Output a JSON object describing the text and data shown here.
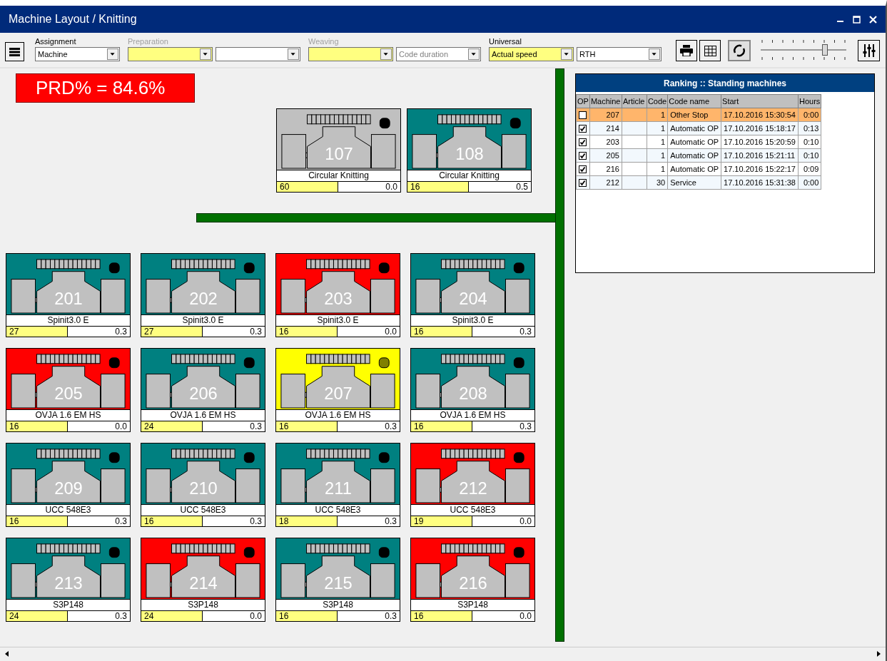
{
  "window": {
    "title": "Machine Layout / Knitting"
  },
  "toolbar": {
    "groups": [
      {
        "label": "Assignment",
        "disabled": false,
        "fields": [
          {
            "value": "Machine",
            "highlighted": false
          }
        ]
      },
      {
        "label": "Preparation",
        "disabled": true,
        "fields": [
          {
            "highlighted": true
          },
          {
            "highlighted": false
          }
        ]
      },
      {
        "label": "Weaving",
        "disabled": true,
        "fields": [
          {
            "highlighted": true
          },
          {
            "placeholder": "Code duration",
            "highlighted": false
          }
        ]
      },
      {
        "label": "Universal",
        "disabled": false,
        "fields": [
          {
            "value": "Actual speed",
            "highlighted": true
          },
          {
            "value": "RTH",
            "highlighted": false
          }
        ]
      }
    ],
    "refresh_pressed": true,
    "zoom": {
      "level": 0.75
    }
  },
  "prd": {
    "text": "PRD% = 84.6%"
  },
  "top_machines": [
    {
      "number": "107",
      "model": "Circular Knitting",
      "count": "60",
      "value": "0.0",
      "color": "#c0c0c0",
      "lamp": {
        "color": "#000000"
      }
    },
    {
      "number": "108",
      "model": "Circular Knitting",
      "count": "16",
      "value": "0.5",
      "color": "#008080",
      "lamp": {
        "color": "#000000"
      }
    }
  ],
  "floor_machines": [
    {
      "number": "201",
      "model": "Spinit3.0 E",
      "count": "27",
      "value": "0.3",
      "color": "#008080",
      "lamp": {
        "color": "#000000"
      }
    },
    {
      "number": "202",
      "model": "Spinit3.0 E",
      "count": "27",
      "value": "0.3",
      "color": "#008080",
      "lamp": {
        "color": "#000000"
      }
    },
    {
      "number": "203",
      "model": "Spinit3.0 E",
      "count": "16",
      "value": "0.0",
      "color": "#ff0000",
      "lamp": {
        "color": "#000000"
      }
    },
    {
      "number": "204",
      "model": "Spinit3.0 E",
      "count": "16",
      "value": "0.3",
      "color": "#008080",
      "lamp": {
        "color": "#000000"
      }
    },
    {
      "number": "205",
      "model": "OVJA 1.6 EM HS",
      "count": "16",
      "value": "0.0",
      "color": "#ff0000",
      "lamp": {
        "color": "#000000"
      }
    },
    {
      "number": "206",
      "model": "OVJA 1.6 EM HS",
      "count": "24",
      "value": "0.3",
      "color": "#008080",
      "lamp": {
        "color": "#000000"
      }
    },
    {
      "number": "207",
      "model": "OVJA 1.6 EM HS",
      "count": "16",
      "value": "0.3",
      "color": "#ffff00",
      "lamp": {
        "color": "#808000"
      }
    },
    {
      "number": "208",
      "model": "OVJA 1.6 EM HS",
      "count": "16",
      "value": "0.3",
      "color": "#008080",
      "lamp": {
        "color": "#000000"
      }
    },
    {
      "number": "209",
      "model": "UCC 548E3",
      "count": "16",
      "value": "0.3",
      "color": "#008080",
      "lamp": {
        "color": "#000000"
      }
    },
    {
      "number": "210",
      "model": "UCC 548E3",
      "count": "16",
      "value": "0.3",
      "color": "#008080",
      "lamp": {
        "color": "#000000"
      }
    },
    {
      "number": "211",
      "model": "UCC 548E3",
      "count": "18",
      "value": "0.3",
      "color": "#008080",
      "lamp": {
        "color": "#000000"
      }
    },
    {
      "number": "212",
      "model": "UCC 548E3",
      "count": "19",
      "value": "0.0",
      "color": "#ff0000",
      "lamp": {
        "color": "#000000"
      }
    },
    {
      "number": "213",
      "model": "S3P148",
      "count": "24",
      "value": "0.3",
      "color": "#008080",
      "lamp": {
        "color": "#000000"
      }
    },
    {
      "number": "214",
      "model": "S3P148",
      "count": "24",
      "value": "0.0",
      "color": "#ff0000",
      "lamp": {
        "color": "#000000"
      }
    },
    {
      "number": "215",
      "model": "S3P148",
      "count": "16",
      "value": "0.3",
      "color": "#008080",
      "lamp": {
        "color": "#000000"
      }
    },
    {
      "number": "216",
      "model": "S3P148",
      "count": "16",
      "value": "0.0",
      "color": "#ff0000",
      "lamp": {
        "color": "#000000"
      }
    }
  ],
  "ranking": {
    "title": "Ranking :: Standing machines",
    "columns": [
      "OP",
      "Machine",
      "Article",
      "Code",
      "Code name",
      "Start",
      "Hours"
    ],
    "rows": [
      {
        "op_checked": false,
        "machine": "207",
        "code": "1",
        "code_name": "Other Stop",
        "start": "17.10.2016 15:30:54",
        "hours": "0:00",
        "selected": true
      },
      {
        "op_checked": true,
        "machine": "214",
        "code": "1",
        "code_name": "Automatic OP",
        "start": "17.10.2016 15:18:17",
        "hours": "0:13",
        "selected": false
      },
      {
        "op_checked": true,
        "machine": "203",
        "code": "1",
        "code_name": "Automatic OP",
        "start": "17.10.2016 15:20:59",
        "hours": "0:10",
        "selected": false
      },
      {
        "op_checked": true,
        "machine": "205",
        "code": "1",
        "code_name": "Automatic OP",
        "start": "17.10.2016 15:21:11",
        "hours": "0:10",
        "selected": false
      },
      {
        "op_checked": true,
        "machine": "216",
        "code": "1",
        "code_name": "Automatic OP",
        "start": "17.10.2016 15:22:17",
        "hours": "0:09",
        "selected": false
      },
      {
        "op_checked": true,
        "machine": "212",
        "code": "30",
        "code_name": "Service",
        "start": "17.10.2016 15:31:38",
        "hours": "0:00",
        "selected": false
      }
    ]
  }
}
